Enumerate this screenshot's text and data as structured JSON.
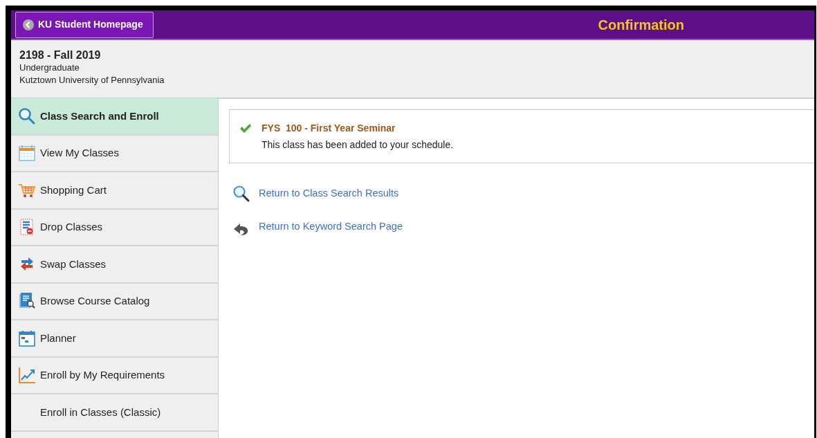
{
  "header": {
    "back_button": "KU Student Homepage",
    "title": "Confirmation"
  },
  "term": {
    "name": "2198 - Fall 2019",
    "career": "Undergraduate",
    "institution": "Kutztown University of Pennsylvania"
  },
  "sidebar": {
    "items": [
      {
        "label": "Class Search and Enroll",
        "kind": "search",
        "selected": true
      },
      {
        "label": "View My Classes",
        "kind": "calendar",
        "selected": false
      },
      {
        "label": "Shopping Cart",
        "kind": "cart",
        "selected": false
      },
      {
        "label": "Drop Classes",
        "kind": "drop",
        "selected": false
      },
      {
        "label": "Swap Classes",
        "kind": "swap",
        "selected": false
      },
      {
        "label": "Browse Course Catalog",
        "kind": "catalog",
        "selected": false
      },
      {
        "label": "Planner",
        "kind": "planner",
        "selected": false
      },
      {
        "label": "Enroll by My Requirements",
        "kind": "chart",
        "selected": false
      },
      {
        "label": "Enroll in Classes (Classic)",
        "kind": "none",
        "selected": false
      }
    ]
  },
  "confirmation": {
    "success": true,
    "class": "FYS  100 - First Year Seminar",
    "message": "This class has been added to your schedule."
  },
  "links": [
    {
      "label": "Return to Class Search Results",
      "kind": "search"
    },
    {
      "label": "Return to Keyword Search Page",
      "kind": "return"
    }
  ]
}
